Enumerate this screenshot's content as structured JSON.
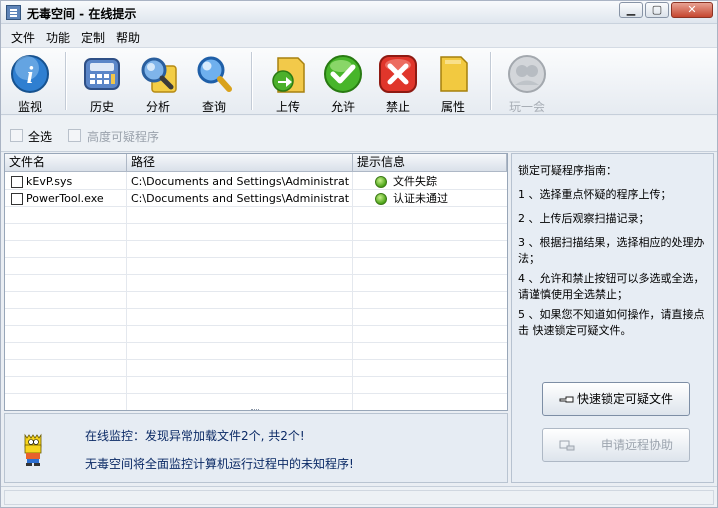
{
  "window": {
    "title": "无毒空间 - 在线提示",
    "controls": [
      "minimize-icon",
      "maximize-icon",
      "close-icon"
    ]
  },
  "menu": [
    "文件",
    "功能",
    "定制",
    "帮助"
  ],
  "toolbar": {
    "monitor": {
      "label": "监视",
      "icon": "info-icon"
    },
    "history": {
      "label": "历史",
      "icon": "calculator-icon"
    },
    "analyze": {
      "label": "分析",
      "icon": "magnifier-folder-icon"
    },
    "query": {
      "label": "查询",
      "icon": "magnifier-icon"
    },
    "upload": {
      "label": "上传",
      "icon": "upload-icon"
    },
    "allow": {
      "label": "允许",
      "icon": "check-icon"
    },
    "forbid": {
      "label": "禁止",
      "icon": "x-icon"
    },
    "properties": {
      "label": "属性",
      "icon": "document-icon"
    },
    "play": {
      "label": "玩一会",
      "icon": "avatar-icon",
      "disabled": true
    }
  },
  "filters": {
    "select_all": "全选",
    "highly_suspicious": "高度可疑程序"
  },
  "table": {
    "columns": [
      "文件名",
      "路径",
      "提示信息"
    ],
    "rows": [
      {
        "name": "kEvP.sys",
        "path": "C:\\Documents and Settings\\Administrator\\...",
        "status": "文件失踪"
      },
      {
        "name": "PowerTool.exe",
        "path": "C:\\Documents and Settings\\Administrator\\...",
        "status": "认证未通过"
      }
    ]
  },
  "bottom": {
    "line1": "在线监控：发现异常加载文件2个, 共2个!",
    "line2": "无毒空间将全面监控计算机运行过程中的未知程序!"
  },
  "guide": {
    "title": "锁定可疑程序指南：",
    "steps": [
      "1 、选择重点怀疑的程序上传；",
      "2 、上传后观察扫描记录；",
      "3 、根据扫描结果，选择相应的处理办法；",
      "4 、允许和禁止按钮可以多选或全选，请谨慎使用全选禁止；",
      "5 、如果您不知道如何操作，请直接点击 快速锁定可疑文件。"
    ]
  },
  "buttons": {
    "quick_lock": "快速锁定可疑文件",
    "remote_help": "申请远程协助"
  },
  "colors": {
    "accent": "#0b2a66",
    "status_green": "#4aa316",
    "close_red": "#c5462f"
  }
}
